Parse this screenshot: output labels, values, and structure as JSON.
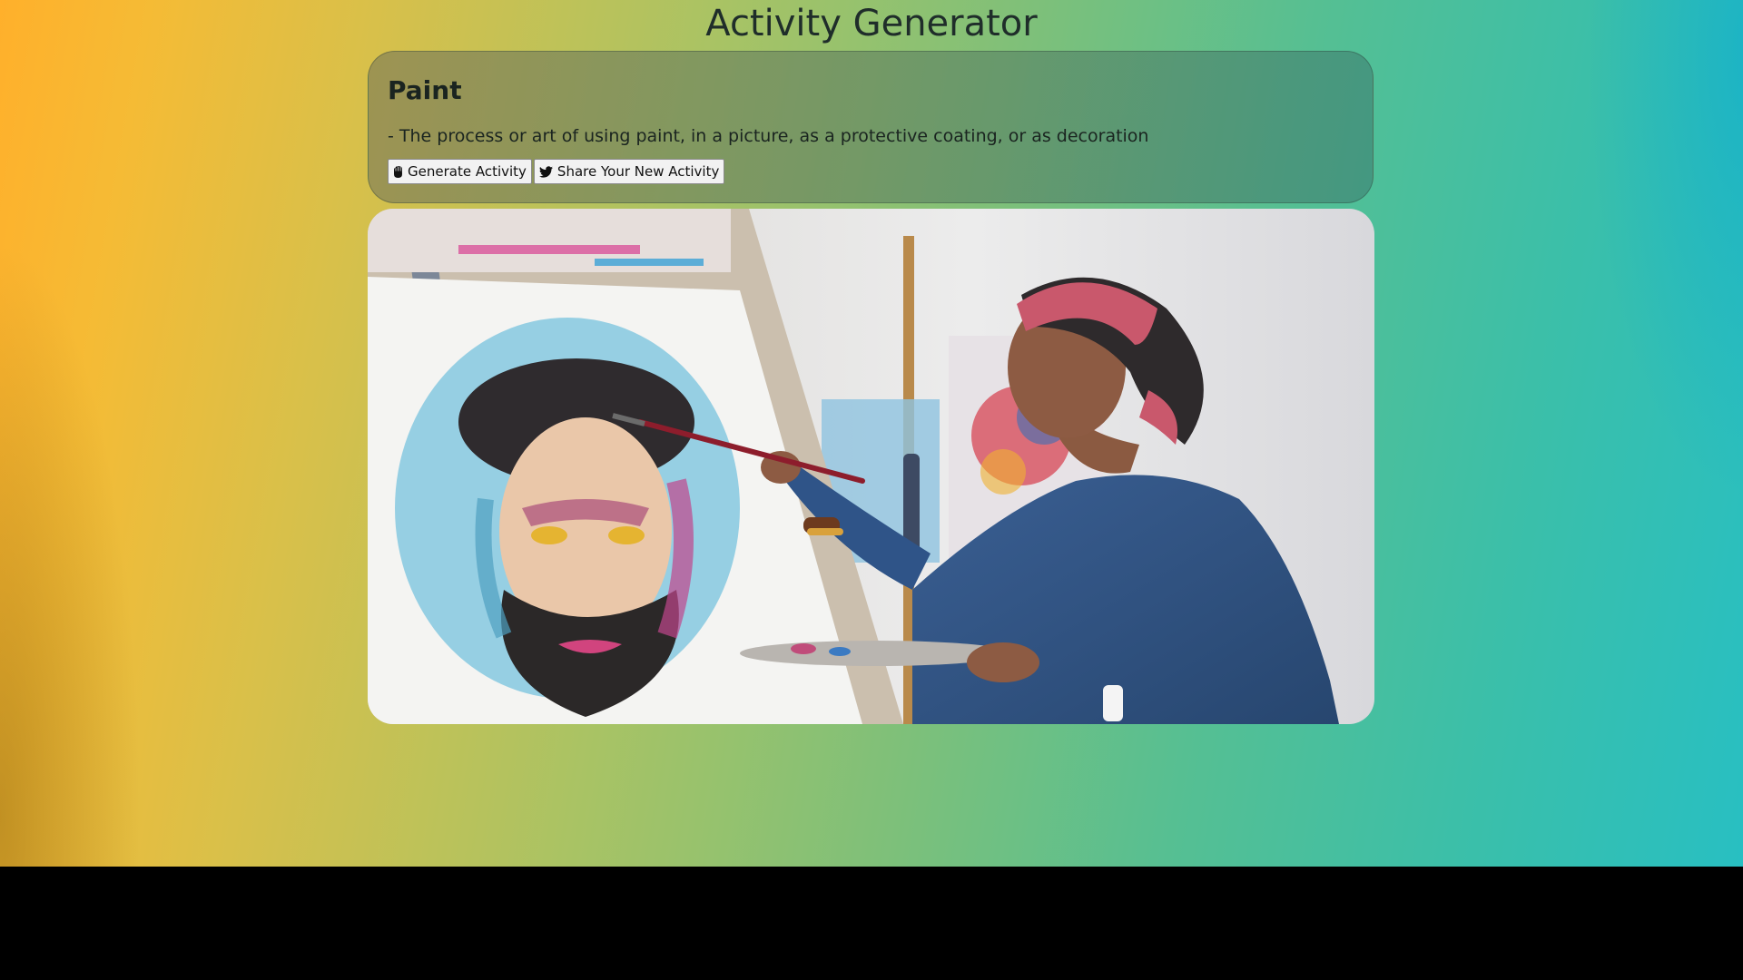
{
  "app": {
    "title": "Activity Generator"
  },
  "activity": {
    "name": "Paint",
    "description": "- The process or art of using paint, in a picture, as a protective coating, or as decoration"
  },
  "buttons": {
    "generate_label": "Generate Activity",
    "generate_icon": "hand-icon",
    "share_label": "Share Your New Activity",
    "share_icon": "twitter-icon"
  },
  "image": {
    "alt": "Paint",
    "subject": "woman-painting-portrait-on-easel"
  },
  "colors": {
    "gradient_left": "#ffb02b",
    "gradient_right": "#28bfc2",
    "card_tint": "#6e7a5a",
    "below_page": "#000000"
  }
}
